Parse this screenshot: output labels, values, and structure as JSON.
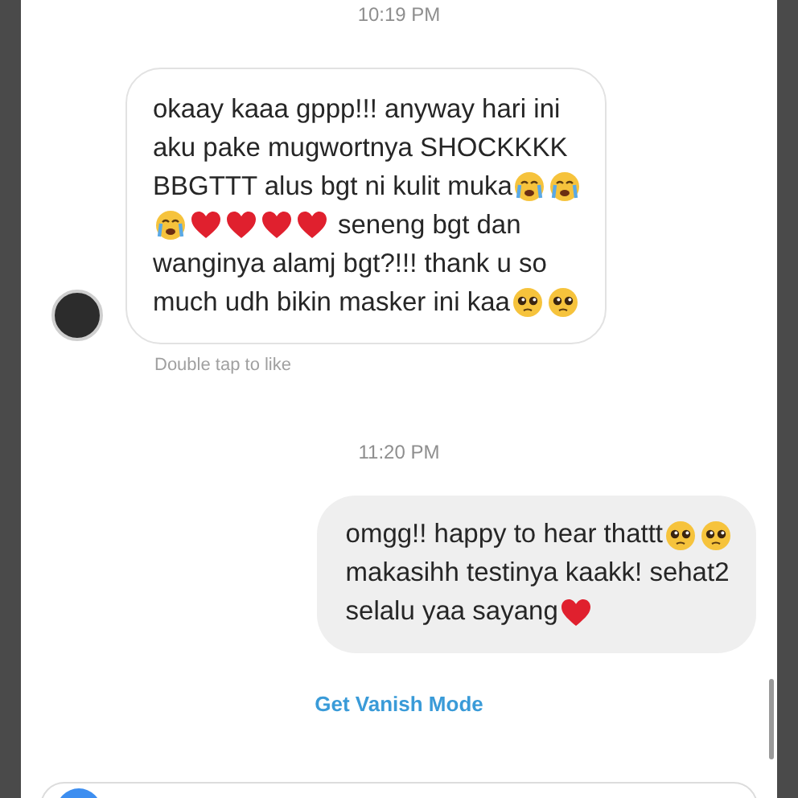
{
  "messages": [
    {
      "kind": "time",
      "text": "10:19 PM"
    },
    {
      "kind": "received",
      "footer": "Double tap to like",
      "lines": [
        [
          {
            "kind": "text",
            "text": "okaay kaaa gppp!!! anyway hari ini"
          }
        ],
        [
          {
            "kind": "text",
            "text": "aku pake mugwortnya SHOCKKKK"
          }
        ],
        [
          {
            "kind": "text",
            "text": "BBGTTT alus bgt ni kulit muka"
          },
          {
            "kind": "crying-face"
          },
          {
            "kind": "crying-face"
          }
        ],
        [
          {
            "kind": "crying-face"
          },
          {
            "kind": "heart"
          },
          {
            "kind": "heart"
          },
          {
            "kind": "heart"
          },
          {
            "kind": "heart"
          },
          {
            "kind": "text",
            "text": "seneng bgt dan"
          }
        ],
        [
          {
            "kind": "text",
            "text": "wanginya alamj bgt?!!! thank u so"
          }
        ],
        [
          {
            "kind": "text",
            "text": "much udh bikin masker ini kaa"
          },
          {
            "kind": "pleading-face"
          },
          {
            "kind": "pleading-face"
          }
        ]
      ]
    },
    {
      "kind": "time",
      "text": "11:20 PM"
    },
    {
      "kind": "sent",
      "lines": [
        [
          {
            "kind": "text",
            "text": "omgg!! happy to hear thattt"
          },
          {
            "kind": "pleading-face"
          },
          {
            "kind": "pleading-face"
          }
        ],
        [
          {
            "kind": "text",
            "text": "makasihh testinya kaakk! sehat2"
          }
        ],
        [
          {
            "kind": "text",
            "text": "selalu yaa sayang"
          },
          {
            "kind": "heart"
          }
        ]
      ]
    },
    {
      "kind": "link",
      "text": "Get Vanish Mode"
    }
  ]
}
